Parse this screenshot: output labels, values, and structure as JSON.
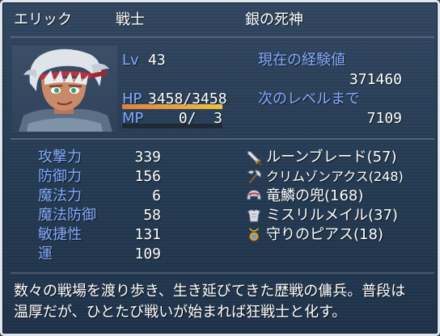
{
  "actor": {
    "name": "エリック",
    "class": "戦士",
    "nickname": "銀の死神",
    "level_label": "Lv",
    "level": "43",
    "hp_label": "HP",
    "hp_value": "3458/3458",
    "hp_ratio": 1.0,
    "mp_label": "MP",
    "mp_value": "0/  3",
    "mp_ratio": 0.0
  },
  "exp": {
    "current_label": "現在の経験値",
    "current_value": "371460",
    "next_label": "次のレベルまで",
    "next_value": "7109"
  },
  "params": [
    {
      "label": "攻撃力",
      "value": "339"
    },
    {
      "label": "防御力",
      "value": "156"
    },
    {
      "label": "魔法力",
      "value": "6"
    },
    {
      "label": "魔法防御",
      "value": "58"
    },
    {
      "label": "敏捷性",
      "value": "131"
    },
    {
      "label": "運",
      "value": "109"
    }
  ],
  "equips": [
    {
      "icon": "sword-icon",
      "name": "ルーンブレード(57)"
    },
    {
      "icon": "axe-icon",
      "name": "クリムゾンアクス(248)"
    },
    {
      "icon": "helmet-icon",
      "name": "竜鱗の兜(168)"
    },
    {
      "icon": "armor-icon",
      "name": "ミスリルメイル(37)"
    },
    {
      "icon": "amulet-icon",
      "name": "守りのピアス(18)"
    }
  ],
  "profile": {
    "line1": "数々の戦場を渡り歩き、生き延びてきた歴戦の傭兵。普段は",
    "line2": "温厚だが、ひとたび戦いが始まれば狂戦士と化す。"
  },
  "colors": {
    "system": "#84aaff",
    "hp_gauge_start": "#e08040",
    "hp_gauge_end": "#f0c040",
    "mp_gauge_start": "#4080c0",
    "mp_gauge_end": "#40c0f0"
  }
}
